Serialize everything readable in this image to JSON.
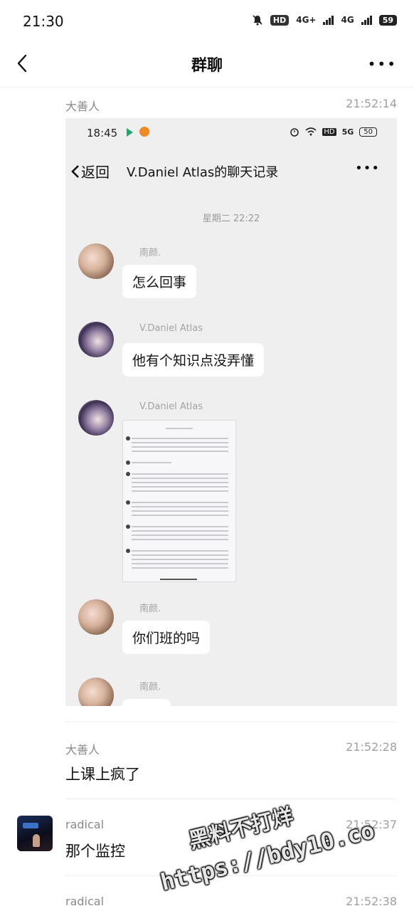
{
  "status_bar": {
    "time": "21:30",
    "hd_label": "HD",
    "net1": "4G+",
    "net2": "4G",
    "battery": "59"
  },
  "header": {
    "title": "群聊",
    "more": "•••"
  },
  "messages": [
    {
      "sender": "大善人",
      "time": "21:52:14"
    },
    {
      "sender": "大善人",
      "time": "21:52:28",
      "text": "上课上疯了"
    },
    {
      "sender": "radical",
      "time": "21:52:37",
      "text": "那个监控"
    },
    {
      "sender": "radical",
      "time": "21:52:38"
    }
  ],
  "embedded_screenshot": {
    "time": "18:45",
    "hd_label": "HD",
    "net": "5G",
    "battery": "50",
    "back_label": "返回",
    "title": "V.Daniel Atlas的聊天记录",
    "more": "•••",
    "date": "星期二 22:22",
    "items": [
      {
        "name": "南颜.",
        "text": "怎么回事"
      },
      {
        "name": "V.Daniel Atlas",
        "text": "他有个知识点没弄懂"
      },
      {
        "name": "V.Daniel Atlas"
      },
      {
        "name": "南颜.",
        "text": "你们班的吗"
      },
      {
        "name": "南颜."
      }
    ]
  },
  "watermark": {
    "line1": "黑料不打烊",
    "line2": "https://bdy10.co"
  }
}
